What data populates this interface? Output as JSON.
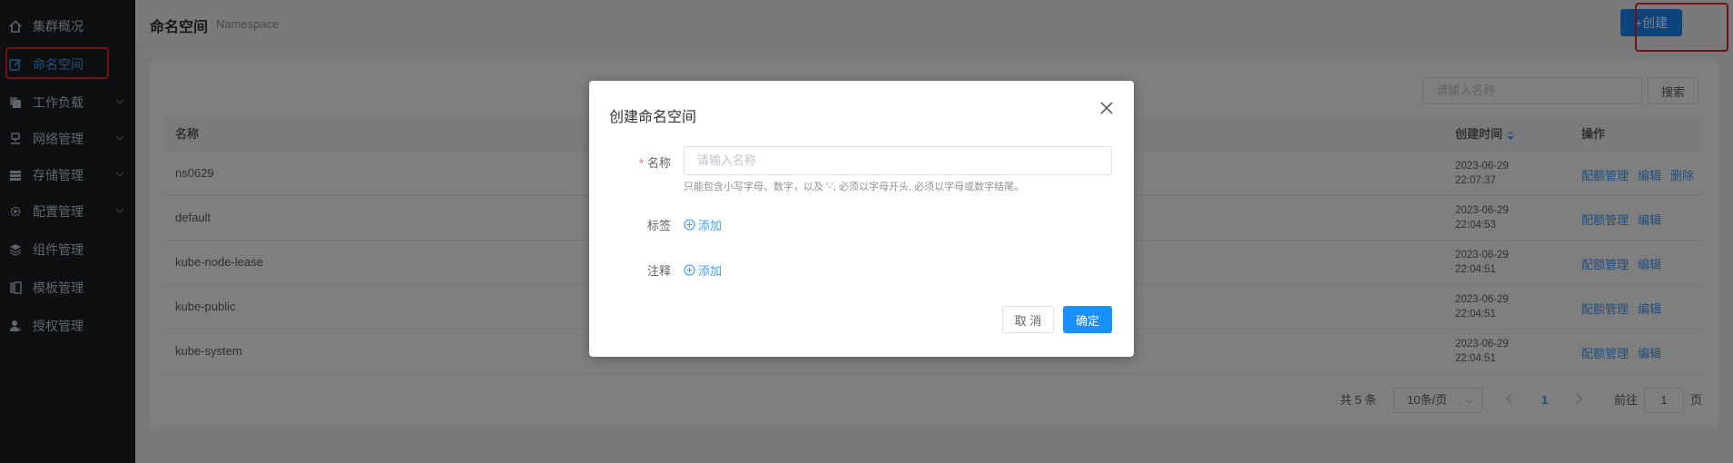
{
  "sidebar": {
    "items": [
      {
        "label": "集群概况",
        "icon": "home-icon",
        "has_children": false,
        "active": false
      },
      {
        "label": "命名空间",
        "icon": "edit-icon",
        "has_children": false,
        "active": true
      },
      {
        "label": "工作负载",
        "icon": "copy-icon",
        "has_children": true,
        "active": false
      },
      {
        "label": "网络管理",
        "icon": "network-icon",
        "has_children": true,
        "active": false
      },
      {
        "label": "存储管理",
        "icon": "storage-icon",
        "has_children": true,
        "active": false
      },
      {
        "label": "配置管理",
        "icon": "gear-icon",
        "has_children": true,
        "active": false
      },
      {
        "label": "组件管理",
        "icon": "layers-icon",
        "has_children": false,
        "active": false
      },
      {
        "label": "模板管理",
        "icon": "template-icon",
        "has_children": false,
        "active": false
      },
      {
        "label": "授权管理",
        "icon": "user-key-icon",
        "has_children": false,
        "active": false
      }
    ]
  },
  "header": {
    "title": "命名空间",
    "subtitle": "Namespace",
    "create_label": "+创建"
  },
  "search": {
    "placeholder": "请输入名称",
    "button_label": "搜索"
  },
  "table": {
    "columns": [
      "名称",
      "创建时间",
      "操作"
    ],
    "rows": [
      {
        "name": "ns0629",
        "date": "2023-06-29",
        "time": "22:07:37",
        "ops": [
          "配额管理",
          "编辑",
          "删除"
        ]
      },
      {
        "name": "default",
        "date": "2023-06-29",
        "time": "22:04:53",
        "ops": [
          "配额管理",
          "编辑"
        ]
      },
      {
        "name": "kube-node-lease",
        "date": "2023-06-29",
        "time": "22:04:51",
        "ops": [
          "配额管理",
          "编辑"
        ]
      },
      {
        "name": "kube-public",
        "date": "2023-06-29",
        "time": "22:04:51",
        "ops": [
          "配额管理",
          "编辑"
        ]
      },
      {
        "name": "kube-system",
        "date": "2023-06-29",
        "time": "22:04:51",
        "ops": [
          "配额管理",
          "编辑"
        ]
      }
    ]
  },
  "pagination": {
    "total": "共 5 条",
    "page_size": "10条/页",
    "current": "1",
    "goto_label": "前往",
    "goto_value": "1",
    "page_suffix": "页"
  },
  "dialog": {
    "title": "创建命名空间",
    "name_label": "名称",
    "name_placeholder": "请输入名称",
    "name_hint": "只能包含小写字母、数字，以及 '-', 必须以字母开头, 必须以字母或数字结尾。",
    "labels_label": "标签",
    "annotations_label": "注释",
    "add_label": "添加",
    "cancel_label": "取 消",
    "confirm_label": "确定"
  },
  "colors": {
    "primary": "#1890ff",
    "sidebar_bg": "#1d1e23",
    "highlight": "#e8232b"
  }
}
